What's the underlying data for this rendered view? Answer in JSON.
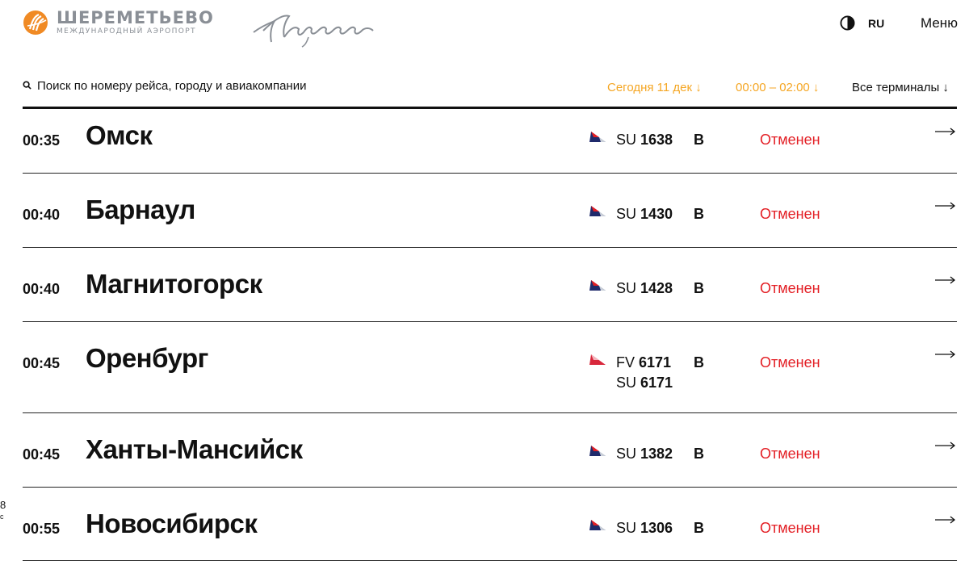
{
  "header": {
    "logo_title": "ШЕРЕМЕТЬЕВО",
    "logo_subtitle": "МЕЖДУНАРОДНЫЙ АЭРОПОРТ",
    "pushkin_signature": "Пушкин",
    "lang": "RU",
    "menu_label": "Меню",
    "brand_color": "#f08a24"
  },
  "filters": {
    "search_placeholder": "Поиск по номеру рейса, городу и авиакомпании",
    "date": "Сегодня 11 дек ↓",
    "time_range": "00:00 – 02:00 ↓",
    "terminals": "Все терминалы ↓",
    "accent_color": "#f5a623"
  },
  "flights": [
    {
      "time": "00:35",
      "city": "Омск",
      "airline_icon": "aeroflot-logo",
      "numbers": [
        {
          "code": "SU",
          "num": "1638"
        }
      ],
      "terminal": "B",
      "status": "Отменен"
    },
    {
      "time": "00:40",
      "city": "Барнаул",
      "airline_icon": "aeroflot-logo",
      "numbers": [
        {
          "code": "SU",
          "num": "1430"
        }
      ],
      "terminal": "B",
      "status": "Отменен"
    },
    {
      "time": "00:40",
      "city": "Магнитогорск",
      "airline_icon": "aeroflot-logo",
      "numbers": [
        {
          "code": "SU",
          "num": "1428"
        }
      ],
      "terminal": "B",
      "status": "Отменен"
    },
    {
      "time": "00:45",
      "city": "Оренбург",
      "airline_icon": "rossiya-logo",
      "numbers": [
        {
          "code": "FV",
          "num": "6171"
        },
        {
          "code": "SU",
          "num": "6171"
        }
      ],
      "terminal": "B",
      "status": "Отменен"
    },
    {
      "time": "00:45",
      "city": "Ханты-Мансийск",
      "airline_icon": "aeroflot-logo",
      "numbers": [
        {
          "code": "SU",
          "num": "1382"
        }
      ],
      "terminal": "B",
      "status": "Отменен"
    },
    {
      "time": "00:55",
      "city": "Новосибирск",
      "airline_icon": "aeroflot-logo",
      "numbers": [
        {
          "code": "SU",
          "num": "1306"
        }
      ],
      "terminal": "B",
      "status": "Отменен"
    }
  ],
  "status_color": "#e31e24",
  "side": {
    "num": "8",
    "sub": "с"
  }
}
